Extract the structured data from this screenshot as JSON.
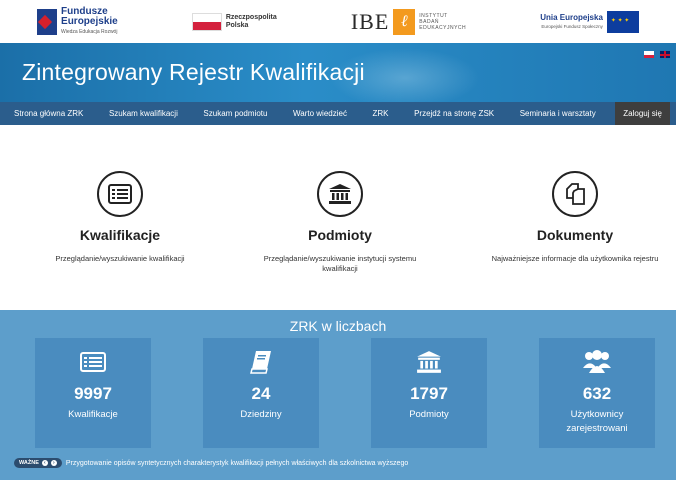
{
  "logos": {
    "fe_line1": "Fundusze",
    "fe_line2": "Europejskie",
    "fe_sub": "Wiedza Edukacja Rozwój",
    "pl_line1": "Rzeczpospolita",
    "pl_line2": "Polska",
    "ibe": "IBE",
    "ibe_sub1": "INSTYTUT",
    "ibe_sub2": "BADAŃ",
    "ibe_sub3": "EDUKACYJNYCH",
    "ue_line1": "Unia Europejska",
    "ue_sub": "Europejski Fundusz Społeczny"
  },
  "banner": {
    "title": "Zintegrowany Rejestr Kwalifikacji"
  },
  "nav": {
    "items": [
      "Strona główna ZRK",
      "Szukam kwalifikacji",
      "Szukam podmiotu",
      "Warto wiedzieć",
      "ZRK",
      "Przejdź na stronę ZSK",
      "Seminaria i warsztaty"
    ],
    "login": "Zaloguj się"
  },
  "features": [
    {
      "title": "Kwalifikacje",
      "desc": "Przeglądanie/wyszukiwanie kwalifikacji",
      "icon": "list-icon"
    },
    {
      "title": "Podmioty",
      "desc": "Przeglądanie/wyszukiwanie instytucji systemu kwalifikacji",
      "icon": "institution-icon"
    },
    {
      "title": "Dokumenty",
      "desc": "Najważniejsze informacje dla użytkownika rejestru",
      "icon": "documents-icon"
    }
  ],
  "stats": {
    "title": "ZRK w liczbach",
    "items": [
      {
        "number": "9997",
        "label": "Kwalifikacje",
        "icon": "list-icon"
      },
      {
        "number": "24",
        "label": "Dziedziny",
        "icon": "book-icon"
      },
      {
        "number": "1797",
        "label": "Podmioty",
        "icon": "institution-icon"
      },
      {
        "number": "632",
        "label": "Użytkownicy zarejestrowani",
        "icon": "users-icon"
      }
    ]
  },
  "news": {
    "badge": "WAŻNE",
    "text": "Przygotowanie opisów syntetycznych charakterystyk kwalifikacji pełnych właściwych dla szkolnictwa wyższego"
  }
}
